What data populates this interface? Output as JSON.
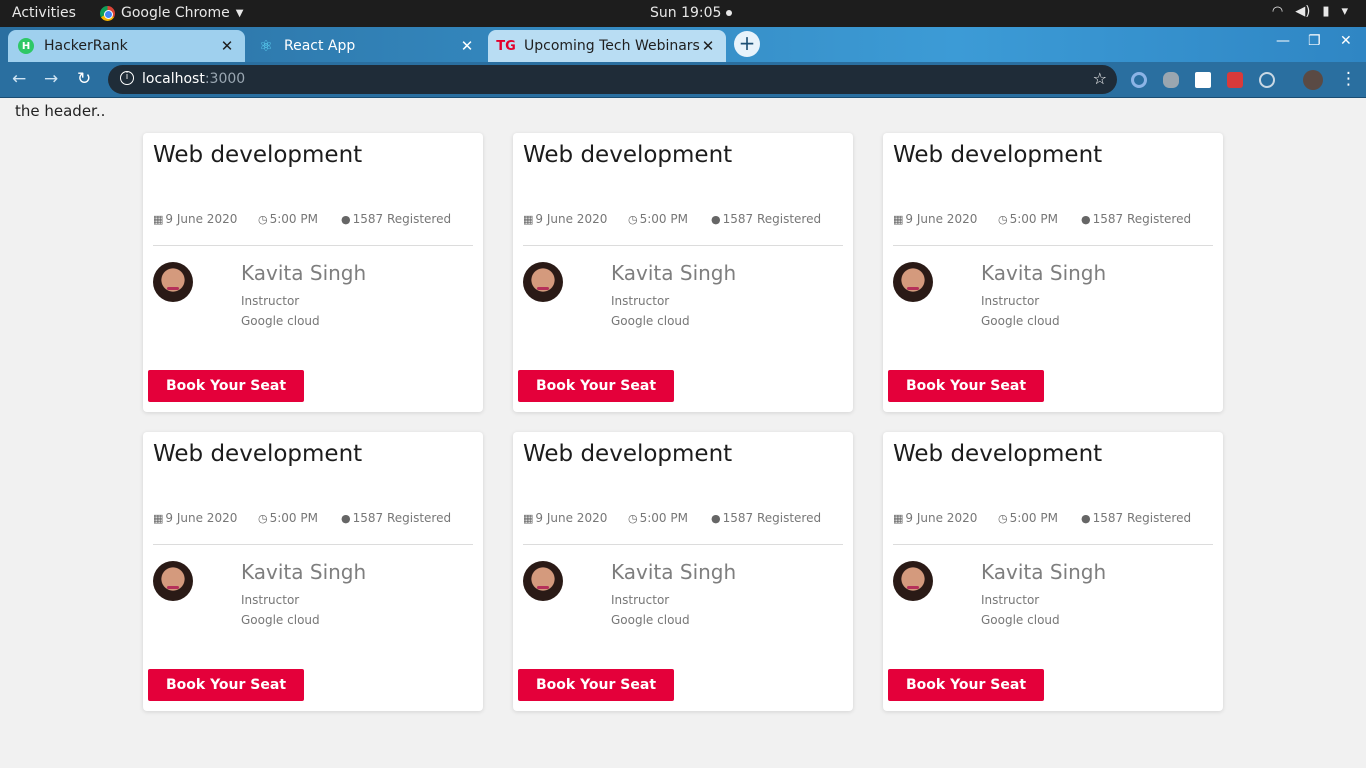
{
  "system_bar": {
    "activities": "Activities",
    "app_name": "Google Chrome",
    "clock": "Sun 19:05"
  },
  "browser": {
    "tabs": [
      {
        "title": "HackerRank",
        "icon": "hackerrank-icon"
      },
      {
        "title": "React App",
        "icon": "react-icon"
      },
      {
        "title": "Upcoming Tech Webinars",
        "icon": "tg-icon"
      }
    ],
    "address": {
      "host": "localhost",
      "port": ":3000"
    }
  },
  "page": {
    "header_text": "the header..",
    "cards": [
      {
        "title": "Web development",
        "date": "9 June 2020",
        "time": "5:00 PM",
        "registered": "1587 Registered",
        "instructor_name": "Kavita Singh",
        "instructor_role": "Instructor",
        "instructor_org": "Google cloud",
        "button_label": "Book Your Seat"
      },
      {
        "title": "Web development",
        "date": "9 June 2020",
        "time": "5:00 PM",
        "registered": "1587 Registered",
        "instructor_name": "Kavita Singh",
        "instructor_role": "Instructor",
        "instructor_org": "Google cloud",
        "button_label": "Book Your Seat"
      },
      {
        "title": "Web development",
        "date": "9 June 2020",
        "time": "5:00 PM",
        "registered": "1587 Registered",
        "instructor_name": "Kavita Singh",
        "instructor_role": "Instructor",
        "instructor_org": "Google cloud",
        "button_label": "Book Your Seat"
      },
      {
        "title": "Web development",
        "date": "9 June 2020",
        "time": "5:00 PM",
        "registered": "1587 Registered",
        "instructor_name": "Kavita Singh",
        "instructor_role": "Instructor",
        "instructor_org": "Google cloud",
        "button_label": "Book Your Seat"
      },
      {
        "title": "Web development",
        "date": "9 June 2020",
        "time": "5:00 PM",
        "registered": "1587 Registered",
        "instructor_name": "Kavita Singh",
        "instructor_role": "Instructor",
        "instructor_org": "Google cloud",
        "button_label": "Book Your Seat"
      },
      {
        "title": "Web development",
        "date": "9 June 2020",
        "time": "5:00 PM",
        "registered": "1587 Registered",
        "instructor_name": "Kavita Singh",
        "instructor_role": "Instructor",
        "instructor_org": "Google cloud",
        "button_label": "Book Your Seat"
      }
    ]
  },
  "colors": {
    "accent_button": "#e4003a",
    "tab_strip": "#3c9bd6",
    "page_background": "#f1f1f1"
  }
}
